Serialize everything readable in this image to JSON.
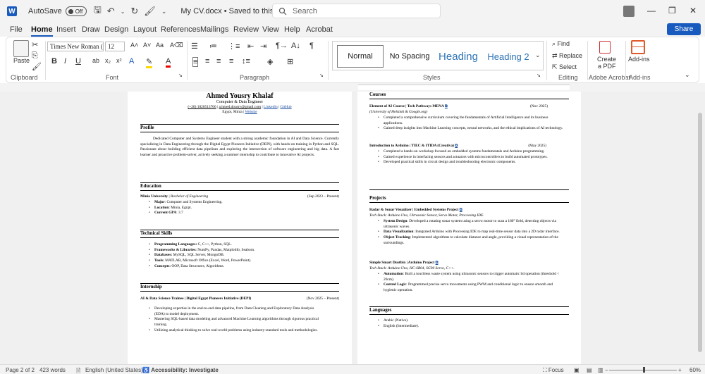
{
  "titlebar": {
    "autosave_label": "AutoSave",
    "autosave_state": "Off",
    "document_title": "My CV.docx",
    "save_status": "Saved to this PC",
    "search_placeholder": "Search"
  },
  "tabs": [
    "File",
    "Home",
    "Insert",
    "Draw",
    "Design",
    "Layout",
    "References",
    "Mailings",
    "Review",
    "View",
    "Help",
    "Acrobat"
  ],
  "share_label": "Share",
  "ribbon": {
    "clipboard": {
      "paste": "Paste",
      "group": "Clipboard"
    },
    "font": {
      "family": "Times New Roman (",
      "size": "12",
      "group": "Font",
      "bold": "B",
      "italic": "I",
      "underline": "U"
    },
    "paragraph": {
      "group": "Paragraph"
    },
    "styles": {
      "items": [
        "Normal",
        "No Spacing",
        "Heading",
        "Heading 2"
      ],
      "group": "Styles"
    },
    "editing": {
      "find": "Find",
      "replace": "Replace",
      "select": "Select",
      "group": "Editing"
    },
    "acrobat": {
      "create_pdf_line1": "Create",
      "create_pdf_line2": "a PDF",
      "group": "Adobe Acrobat"
    },
    "addins": {
      "label": "Add-ins",
      "group": "Add-ins"
    }
  },
  "page1": {
    "name": "Ahmed Yousry Khalaf",
    "role": "Computer & Data Engineer",
    "contact_line": "(+20) 1020513706 | a.hmed.dousry@gmail.com | LinkedIn | GitHub",
    "phone": "(+20) 1020513706",
    "email": "a.hmed.dousry@gmail.com",
    "linkedin": "LinkedIn",
    "github": "GitHub",
    "location_line": "Egypt, Minia |",
    "website": "Website",
    "profile_title": "Profile",
    "profile_text": "Dedicated Computer and Systems Engineer student with a strong academic foundation in AI and Data Science. Currently specializing in Data Engineering through the Digital Egypt Pioneers Initiative (DEPI), with hands-on training in Python and SQL. Passionate about building efficient data pipelines and exploring the intersection of software engineering and big data. A fast learner and proactive problem-solver, actively seeking a summer internship to contribute to innovative AI projects.",
    "education_title": "Education",
    "edu_school": "Minia University",
    "edu_degree": "Bachelor of Engineering",
    "edu_dates": "(Sep 2023 – Present)",
    "edu_items": [
      {
        "k": "Major",
        "v": ": Computer and Systems Engineering."
      },
      {
        "k": "Location",
        "v": ": Minia, Egypt."
      },
      {
        "k": "Current GPA",
        "v": ": 3.7"
      }
    ],
    "skills_title": "Technical Skills",
    "skills": [
      {
        "k": "Programming Languages:",
        "v": " C, C++, Python, SQL."
      },
      {
        "k": "Frameworks & Libraries:",
        "v": " NumPy, Pandas, Matplotlib, Seaborn."
      },
      {
        "k": "Databases:",
        "v": " MySQL, SQL Server, MongoDB."
      },
      {
        "k": "Tools:",
        "v": " MATLAB, Microsoft Office (Excel, Word, PowerPoint)."
      },
      {
        "k": "Concepts:",
        "v": " OOP, Data Structures, Algorithms."
      }
    ],
    "internship_title": "Internship",
    "intern_role": "AI & Data Science Trainee | Digital Egypt Pioneers Initiative (DEPI)",
    "intern_dates": "(Nov 2025 – Present)",
    "intern_items": [
      "Developing expertise in the end-to-end data pipeline, from Data Cleaning and Exploratory Data Analysis (EDA) to model deployment.",
      "Mastering SQL-based data modeling and advanced Machine Learning algorithms through rigorous practical training.",
      "Utilizing analytical thinking to solve real-world problems using industry-standard tools and methodologies."
    ]
  },
  "page2": {
    "courses_title": "Courses",
    "course1_title": "Element of AI Course | Tech Pathways MENA",
    "course1_dates": "(Nov 2025)",
    "course1_org": "(University of Helsinki & Google.org)",
    "course1_items": [
      "Completed a comprehensive curriculum covering the fundamentals of Artificial Intelligence and its business applications.",
      "Gained deep insights into Machine Learning concepts, neural networks, and the ethical implications of AI technology."
    ],
    "course2_title": "Introduction to Arduino | TIEC & ITIDA (Creativa)",
    "course2_dates": "(May 2025)",
    "course2_items": [
      "Completed a hands-on workshop focused on embedded systems fundamentals and Arduino programming.",
      "Gained experience in interfacing sensors and actuators with microcontrollers to build automated prototypes.",
      "Developed practical skills in circuit design and troubleshooting electronic components."
    ],
    "projects_title": "Projects",
    "proj1_title": "Radar & Sonar Visualizer | Embedded Systems Project",
    "proj1_stack": "Tech Stack: Arduino Uno, Ultrasonic Sensor, Servo Motor, Processing IDE.",
    "proj1_items": [
      {
        "k": "System Design",
        "v": ": Developed a rotating sonar system using a servo motor to scan a 180° field, detecting objects via ultrasonic waves."
      },
      {
        "k": "Data Visualization",
        "v": ": Integrated Arduino with Processing IDE to map real-time sensor data into a 2D radar interface."
      },
      {
        "k": "Object Tracking",
        "v": ": Implemented algorithms to calculate distance and angle, providing a visual representation of the surroundings."
      }
    ],
    "proj2_title": "Simple Smart Dustbin | Arduino Project",
    "proj2_stack": "Tech Stack: Arduino Uno, HC-SR04, SG90 Servo, C++.",
    "proj2_items": [
      {
        "k": "Automation",
        "v": ": Built a touchless waste system using ultrasonic sensors to trigger automatic lid operation (threshold < 20cm)."
      },
      {
        "k": "Control Logic",
        "v": ": Programmed precise servo movements using PWM and conditional logic to ensure smooth and hygienic operation."
      }
    ],
    "languages_title": "Languages",
    "languages": [
      "Arabic (Native).",
      "English (Intermediate)."
    ]
  },
  "status": {
    "page": "Page 2 of 2",
    "words": "423 words",
    "language": "English (United States)",
    "accessibility": "Accessibility: Investigate",
    "focus": "Focus",
    "zoom": "60%"
  }
}
